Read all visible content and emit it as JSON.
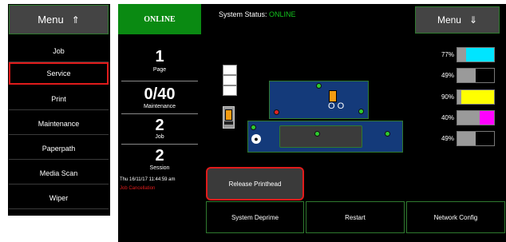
{
  "left_menu": {
    "button_label": "Menu",
    "button_arrow": "⇑",
    "items": [
      {
        "label": "Job"
      },
      {
        "label": "Service",
        "selected": true
      },
      {
        "label": "Print"
      },
      {
        "label": "Maintenance"
      },
      {
        "label": "Paperpath"
      },
      {
        "label": "Media Scan"
      },
      {
        "label": "Wiper"
      }
    ]
  },
  "header": {
    "online_tab": "ONLINE",
    "status_label": "System Status:",
    "status_value": "ONLINE",
    "menu_label": "Menu",
    "menu_arrow": "⇓"
  },
  "counters": [
    {
      "value": "1",
      "label": "Page"
    },
    {
      "value": "0/40",
      "label": "Maintenance"
    },
    {
      "value": "2",
      "label": "Job"
    },
    {
      "value": "2",
      "label": "Session"
    }
  ],
  "datetime": "Thu 16/11/17 11:44:59 am",
  "job_state": "Job Cancellation",
  "diagram": {
    "carriage_rings": "O O",
    "drop_icon": "drop-icon"
  },
  "inks": [
    {
      "percent": "77%",
      "level": 0.77,
      "color": "#00e5ff"
    },
    {
      "percent": "49%",
      "level": 0.49,
      "color": "#000000"
    },
    {
      "percent": "90%",
      "level": 0.9,
      "color": "#ffff00"
    },
    {
      "percent": "40%",
      "level": 0.4,
      "color": "#ff00ff"
    },
    {
      "percent": "49%",
      "level": 0.49,
      "color": "#000000"
    }
  ],
  "buttons": {
    "release_printhead": "Release Printhead",
    "system_deprime": "System Deprime",
    "restart": "Restart",
    "network_config": "Network Config"
  },
  "colors": {
    "online_green": "#0a8a12",
    "status_green": "#13c41e",
    "frame_green": "#2f7a2f",
    "selected_red": "#e01b1b",
    "diagram_blue": "#143a7a"
  }
}
